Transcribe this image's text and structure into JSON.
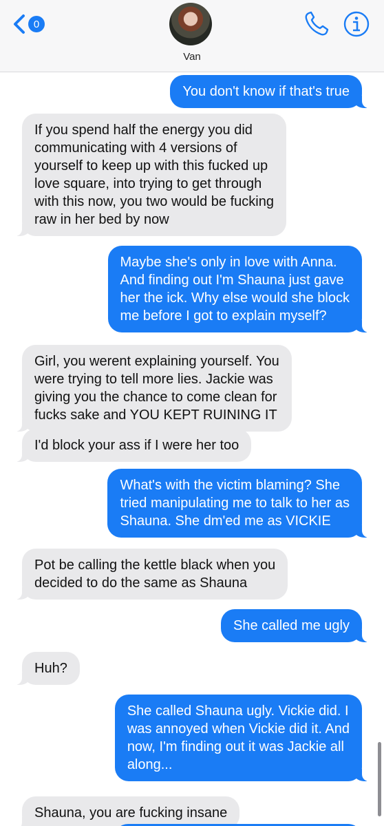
{
  "header": {
    "back_badge": "0",
    "contact_name": "Van",
    "icons": [
      "back-chevron-icon",
      "phone-icon",
      "info-icon"
    ],
    "accent_color": "#1a7cf5"
  },
  "messages": [
    {
      "sender": "me",
      "text": "You don't know if that's true"
    },
    {
      "sender": "them",
      "text": "If you spend half the energy you did\ncommunicating with  4 versions of\nyourself to keep up with this fucked up\nlove square, into trying to get through\nwith this now, you two would be fucking\nraw in her bed by now"
    },
    {
      "sender": "me",
      "text": "Maybe she's only in love with Anna.\nAnd finding out I'm Shauna just gave\nher the ick. Why else would she block\nme before I got to explain myself?"
    },
    {
      "sender": "them",
      "text": "Girl, you werent explaining yourself. You\nwere trying to tell more lies. Jackie was\ngiving you the chance to come clean for\nfucks sake and YOU KEPT RUINING IT"
    },
    {
      "sender": "them",
      "text": "I'd block your ass if I were her too"
    },
    {
      "sender": "me",
      "text": "What's with the victim blaming? She\ntried manipulating me to talk to her as\nShauna. She dm'ed me as VICKIE"
    },
    {
      "sender": "them",
      "text": "Pot be calling the kettle black when you\ndecided to do the same as Shauna"
    },
    {
      "sender": "me",
      "text": "She called me ugly"
    },
    {
      "sender": "them",
      "text": "Huh?"
    },
    {
      "sender": "me",
      "text": "She called Shauna ugly. Vickie did. I\nwas annoyed when Vickie did it. And\nnow, I'm finding out it was Jackie all\nalong..."
    },
    {
      "sender": "them",
      "text": "Shauna, you are fucking insane"
    }
  ]
}
